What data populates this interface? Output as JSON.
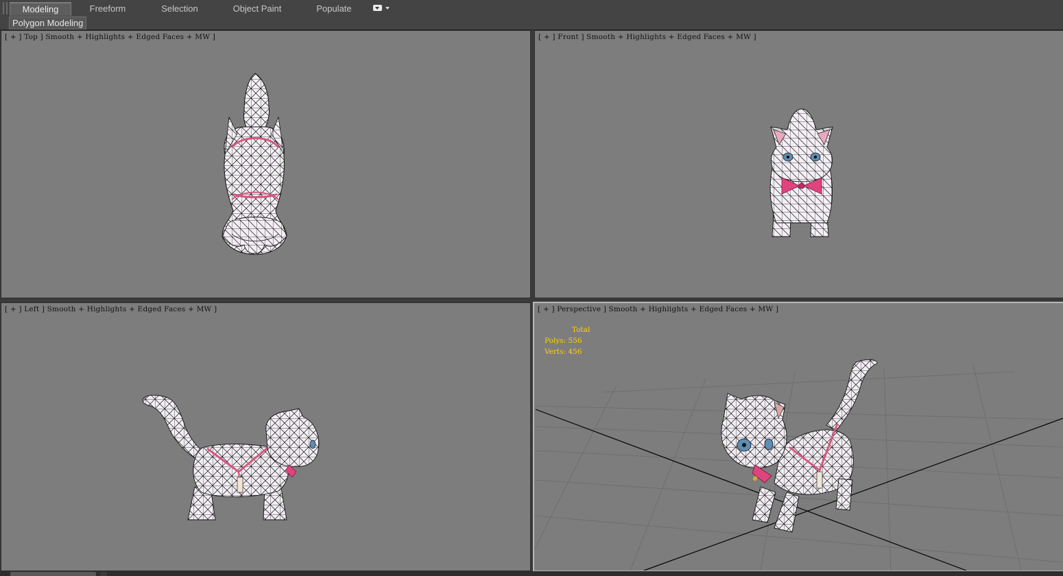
{
  "ribbon": {
    "tabs": [
      {
        "label": "Modeling",
        "active": true
      },
      {
        "label": "Freeform",
        "active": false
      },
      {
        "label": "Selection",
        "active": false
      },
      {
        "label": "Object Paint",
        "active": false
      },
      {
        "label": "Populate",
        "active": false
      }
    ],
    "customize_icon": "dropdown-menu-icon",
    "panel_label": "Polygon Modeling"
  },
  "viewports": {
    "top": {
      "label": "[ + ] Top ] Smooth + Highlights + Edged Faces + MW ]"
    },
    "front": {
      "label": "[ + ] Front ] Smooth + Highlights + Edged Faces + MW ]"
    },
    "left": {
      "label": "[ + ] Left ] Smooth + Highlights + Edged Faces + MW ]"
    },
    "perspective": {
      "label": "[ + ] Perspective ] Smooth + Highlights + Edged Faces + MW ]",
      "stats": {
        "heading": "Total",
        "polys_label": "Polys:",
        "polys_value": "556",
        "verts_label": "Verts:",
        "verts_value": "456"
      }
    }
  },
  "colors": {
    "viewport_bg": "#7d7d7d",
    "stats_text": "#ffd400",
    "model_fill": "#f2eef4",
    "collar": "#e0447e",
    "ribbon_bg": "#444444"
  }
}
